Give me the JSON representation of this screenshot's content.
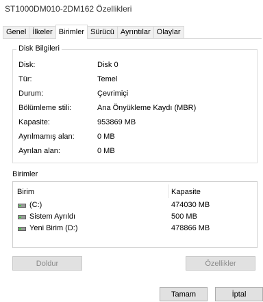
{
  "window": {
    "title": "ST1000DM010-2DM162 Özellikleri"
  },
  "tabs": [
    {
      "label": "Genel"
    },
    {
      "label": "İlkeler"
    },
    {
      "label": "Birimler"
    },
    {
      "label": "Sürücü"
    },
    {
      "label": "Ayrıntılar"
    },
    {
      "label": "Olaylar"
    }
  ],
  "disk_info": {
    "legend": "Disk Bilgileri",
    "rows": [
      {
        "label": "Disk:",
        "value": "Disk 0"
      },
      {
        "label": "Tür:",
        "value": "Temel"
      },
      {
        "label": "Durum:",
        "value": "Çevrimiçi"
      },
      {
        "label": "Bölümleme stili:",
        "value": "Ana Önyükleme Kaydı (MBR)"
      },
      {
        "label": "Kapasite:",
        "value": "953869 MB"
      },
      {
        "label": "Ayrılmamış alan:",
        "value": "0 MB"
      },
      {
        "label": "Ayrılan alan:",
        "value": "0 MB"
      }
    ]
  },
  "volumes": {
    "section_label": "Birimler",
    "headers": {
      "name": "Birim",
      "capacity": "Kapasite"
    },
    "rows": [
      {
        "name": "(C:)",
        "capacity": "474030 MB"
      },
      {
        "name": "Sistem Ayrıldı",
        "capacity": "500 MB"
      },
      {
        "name": "Yeni Birim (D:)",
        "capacity": "478866 MB"
      }
    ]
  },
  "buttons": {
    "populate": "Doldur",
    "properties": "Özellikler",
    "ok": "Tamam",
    "cancel": "İptal"
  }
}
